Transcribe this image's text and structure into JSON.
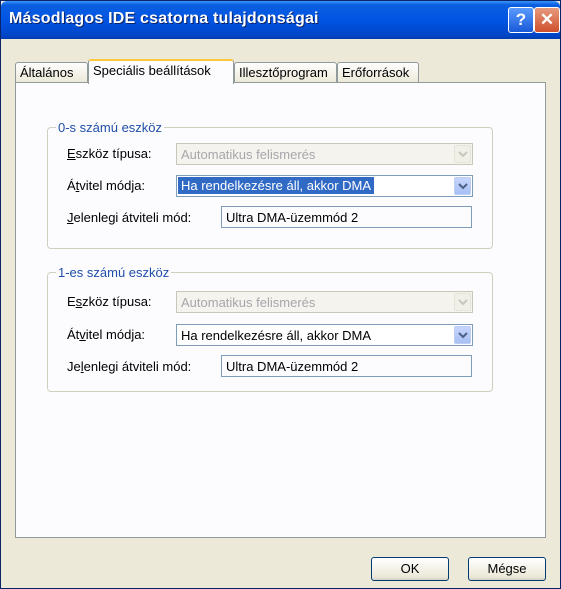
{
  "window": {
    "title": "Másodlagos IDE csatorna tulajdonságai",
    "help_glyph": "?",
    "close_glyph": "✕"
  },
  "tabs": [
    {
      "label": "Általános"
    },
    {
      "label": "Speciális beállítások"
    },
    {
      "label": "Illesztőprogram"
    },
    {
      "label": "Erőforrások"
    }
  ],
  "device0": {
    "group_title": "0-s számú eszköz",
    "type_label": {
      "access": "E",
      "rest": "szköz típusa:"
    },
    "type_value": "Automatikus felismerés",
    "mode_label": {
      "pre": "Á",
      "access": "t",
      "rest": "vitel módja:"
    },
    "mode_value": "Ha rendelkezésre áll, akkor DMA",
    "current_label": {
      "access": "J",
      "rest": "elenlegi átviteli mód:"
    },
    "current_value": "Ultra DMA-üzemmód 2"
  },
  "device1": {
    "group_title": "1-es számú eszköz",
    "type_label": {
      "pre": "E",
      "access": "s",
      "rest": "zköz típusa:"
    },
    "type_value": "Automatikus felismerés",
    "mode_label": {
      "pre": "Át",
      "access": "v",
      "rest": "itel módja:"
    },
    "mode_value": "Ha rendelkezésre áll, akkor DMA",
    "current_label": {
      "pre": "Je",
      "access": "l",
      "rest": "enlegi átviteli mód:"
    },
    "current_value": "Ultra DMA-üzemmód 2"
  },
  "buttons": {
    "ok": "OK",
    "cancel": "Mégse"
  }
}
